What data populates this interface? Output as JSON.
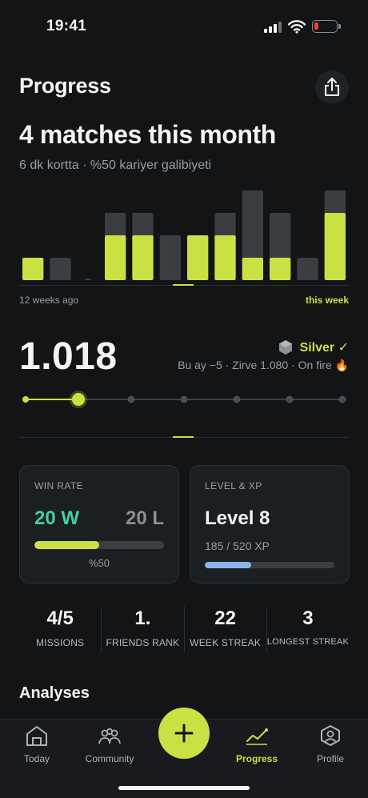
{
  "status_bar": {
    "time": "19:41"
  },
  "header": {
    "title": "Progress"
  },
  "summary": {
    "headline": "4 matches this month",
    "subline": "6 dk kortta · %50 kariyer galibiyeti"
  },
  "weekly_chart": {
    "start_label": "12 weeks ago",
    "end_label": "this week",
    "colors": {
      "won": "#cbe043",
      "total": "#3a3e43"
    },
    "weeks": [
      {
        "won": 1,
        "total": 1
      },
      {
        "won": 0,
        "total": 1
      },
      {
        "won": 0,
        "total": 0
      },
      {
        "won": 2,
        "total": 3
      },
      {
        "won": 2,
        "total": 3
      },
      {
        "won": 0,
        "total": 2
      },
      {
        "won": 2,
        "total": 2
      },
      {
        "won": 2,
        "total": 3
      },
      {
        "won": 1,
        "total": 4
      },
      {
        "won": 1,
        "total": 3
      },
      {
        "won": 0,
        "total": 1
      },
      {
        "won": 3,
        "total": 4
      }
    ]
  },
  "rating": {
    "value": "1.018",
    "tier": "Silver ✓",
    "detail": "Bu ay −5 · Zirve 1.080 · On fire 🔥",
    "track_steps": 7,
    "track_current_step": 1
  },
  "cards": {
    "win_rate": {
      "label": "WIN RATE",
      "wins": "20 W",
      "losses": "20 L",
      "percent_text": "%50",
      "fraction": 0.5
    },
    "level": {
      "label": "LEVEL & XP",
      "level": "Level 8",
      "xp_text": "185 / 520 XP",
      "fraction": 0.356
    }
  },
  "stats": [
    {
      "value": "4/5",
      "label": "MISSIONS"
    },
    {
      "value": "1.",
      "label": "FRIENDS RANK"
    },
    {
      "value": "22",
      "label": "WEEK STREAK"
    },
    {
      "value": "3",
      "label": "LONGEST STREAK"
    }
  ],
  "sections": {
    "analyses": "Analyses"
  },
  "tabs": [
    {
      "label": "Today",
      "icon": "home-icon"
    },
    {
      "label": "Community",
      "icon": "people-icon"
    },
    {
      "label": "Progress",
      "icon": "chart-line-icon",
      "active": true
    },
    {
      "label": "Profile",
      "icon": "profile-icon"
    }
  ],
  "fab": {
    "icon": "plus-icon"
  }
}
